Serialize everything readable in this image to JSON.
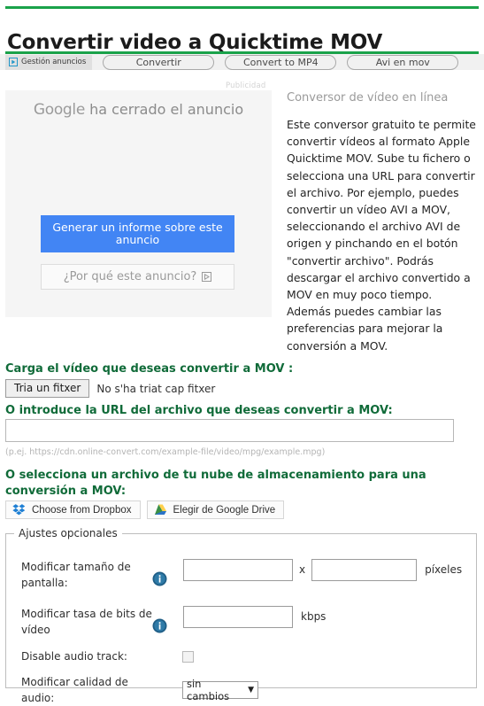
{
  "page": {
    "title": "Convertir video a Quicktime MOV",
    "accent_green": "#1aa24a",
    "heading_green": "#106b39"
  },
  "nav": {
    "badge": {
      "label": "Gestión anuncios",
      "icon": "play-triangle-icon"
    },
    "pills": [
      {
        "label": "Convertir"
      },
      {
        "label": "Convert to MP4"
      },
      {
        "label": "Avi en mov"
      }
    ]
  },
  "ad": {
    "publicidad_label": "Publicidad",
    "brand": "Google",
    "headline_rest": " ha cerrado el anuncio",
    "report_button": "Generar un informe sobre este anuncio",
    "why_button": "¿Por qué este anuncio?",
    "button_color": "#4285f4"
  },
  "sidebar": {
    "title": "Conversor de vídeo en línea",
    "body": "Este conversor gratuito te permite convertir vídeos al formato Apple Quicktime MOV. Sube tu fichero o selecciona una URL para convertir el archivo. Por ejemplo, puedes convertir un vídeo AVI a MOV, seleccionando el archivo AVI de origen y pinchando en el botón \"convertir archivo\". Podrás descargar el archivo convertido a MOV en muy poco tiempo. Además puedes cambiar las preferencias para mejorar la conversión a MOV."
  },
  "upload": {
    "heading": "Carga el vídeo que deseas convertir a MOV :",
    "file_button": "Tria un fitxer",
    "file_status": "No s'ha triat cap fitxer"
  },
  "url": {
    "heading": "O introduce la URL del archivo que deseas convertir a MOV:",
    "value": "",
    "placeholder": "",
    "hint": "(p.ej. https://cdn.online-convert.com/example-file/video/mpg/example.mpg)"
  },
  "cloud": {
    "heading": "O selecciona un archivo de tu nube de almacenamiento para una conversión a MOV:",
    "dropbox_button": "Choose from Dropbox",
    "dropbox_icon": "dropbox-icon",
    "drive_button": "Elegir de Google Drive",
    "drive_icon": "google-drive-icon"
  },
  "settings": {
    "legend": "Ajustes opcionales",
    "rows": [
      {
        "label": "Modificar tamaño de pantalla:",
        "icon": "info-icon",
        "width_value": "",
        "separator": "x",
        "height_value": "",
        "unit": "píxeles"
      },
      {
        "label": "Modificar tasa de bits de vídeo",
        "icon": "info-icon",
        "value": "",
        "unit": "kbps"
      },
      {
        "label": "Disable audio track:",
        "checked": false
      },
      {
        "label": "Modificar calidad de audio:",
        "selected": "sin cambios",
        "caret": "▼"
      }
    ]
  }
}
